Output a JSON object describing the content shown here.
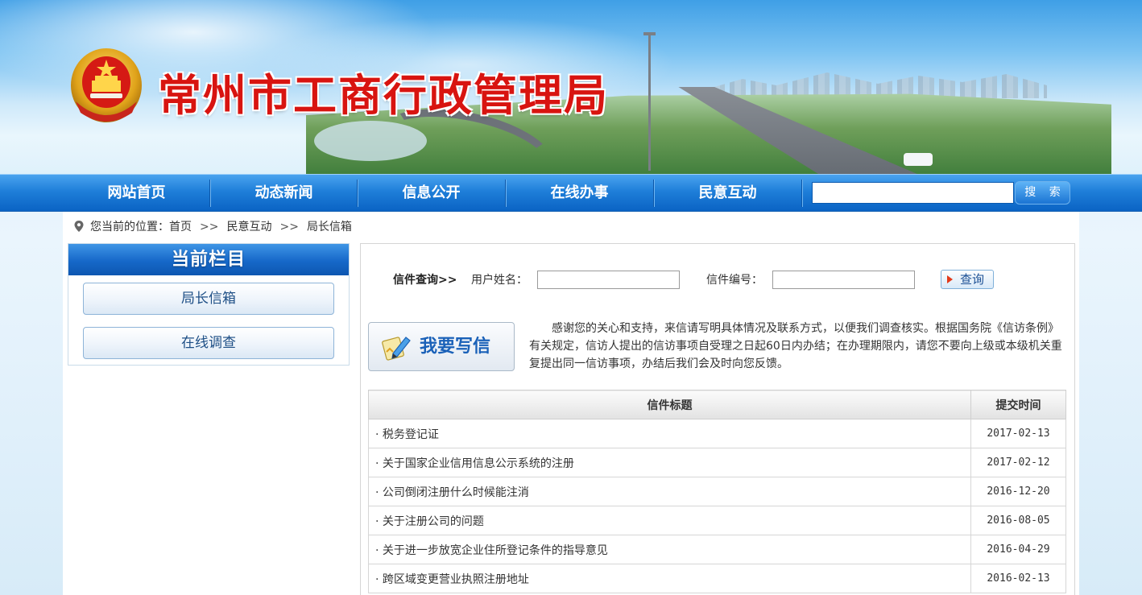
{
  "header": {
    "title": "常州市工商行政管理局"
  },
  "nav": {
    "items": [
      {
        "label": "网站首页"
      },
      {
        "label": "动态新闻"
      },
      {
        "label": "信息公开"
      },
      {
        "label": "在线办事"
      },
      {
        "label": "民意互动"
      }
    ],
    "search_value": "",
    "search_button": "搜 索"
  },
  "breadcrumb": {
    "prefix": "您当前的位置：",
    "items": [
      "首页",
      "民意互动",
      "局长信箱"
    ],
    "separator": ">>"
  },
  "sidebar": {
    "heading": "当前栏目",
    "items": [
      {
        "label": "局长信箱"
      },
      {
        "label": "在线调查"
      }
    ]
  },
  "query": {
    "title": "信件查询>>",
    "name_label": "用户姓名：",
    "name_value": "",
    "number_label": "信件编号：",
    "number_value": "",
    "button": "查询"
  },
  "write_button": "我要写信",
  "notice": "感谢您的关心和支持，来信请写明具体情况及联系方式，以便我们调查核实。根据国务院《信访条例》有关规定，信访人提出的信访事项自受理之日起60日内办结；在办理期限内，请您不要向上级或本级机关重复提出同一信访事项，办结后我们会及时向您反馈。",
  "letters": {
    "columns": [
      "信件标题",
      "提交时间"
    ],
    "rows": [
      {
        "title": "· 税务登记证",
        "date": "2017-02-13"
      },
      {
        "title": "· 关于国家企业信用信息公示系统的注册",
        "date": "2017-02-12"
      },
      {
        "title": "· 公司倒闭注册什么时候能注消",
        "date": "2016-12-20"
      },
      {
        "title": "· 关于注册公司的问题",
        "date": "2016-08-05"
      },
      {
        "title": "· 关于进一步放宽企业住所登记条件的指导意见",
        "date": "2016-04-29"
      },
      {
        "title": "· 跨区域变更营业执照注册地址",
        "date": "2016-02-13"
      }
    ]
  },
  "colors": {
    "nav_blue": "#1f7fd9",
    "title_red": "#d81410",
    "sidebar_text": "#1e4f86"
  }
}
